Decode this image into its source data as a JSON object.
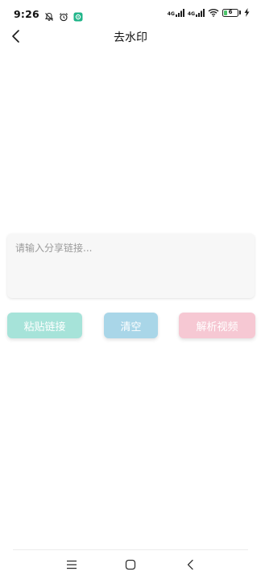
{
  "status_bar": {
    "time": "9:26",
    "icons": [
      "bell-off-icon",
      "alarm-clock-icon",
      "app-notification-icon",
      "signal-icon",
      "signal-icon",
      "wifi-icon",
      "battery-icon",
      "charging-icon"
    ],
    "signal_label_1": "4G",
    "signal_label_2": "4G",
    "battery_level": "6",
    "battery_fraction": 0.06,
    "colors": {
      "notification_app": "#21b58a",
      "battery_fill": "#4cc36a"
    }
  },
  "header": {
    "title": "去水印",
    "back_icon": "chevron-left-icon"
  },
  "main": {
    "input": {
      "value": "",
      "placeholder": "请输入分享链接..."
    },
    "buttons": {
      "paste_label": "粘贴链接",
      "clear_label": "清空",
      "parse_label": "解析视频"
    },
    "colors": {
      "paste_button": "#a6e3d9",
      "clear_button": "#a9d6e8",
      "parse_button": "#f6c8d3"
    }
  },
  "nav_bar": {
    "icons": [
      "menu-icon",
      "home-square-icon",
      "back-triangle-icon"
    ]
  }
}
